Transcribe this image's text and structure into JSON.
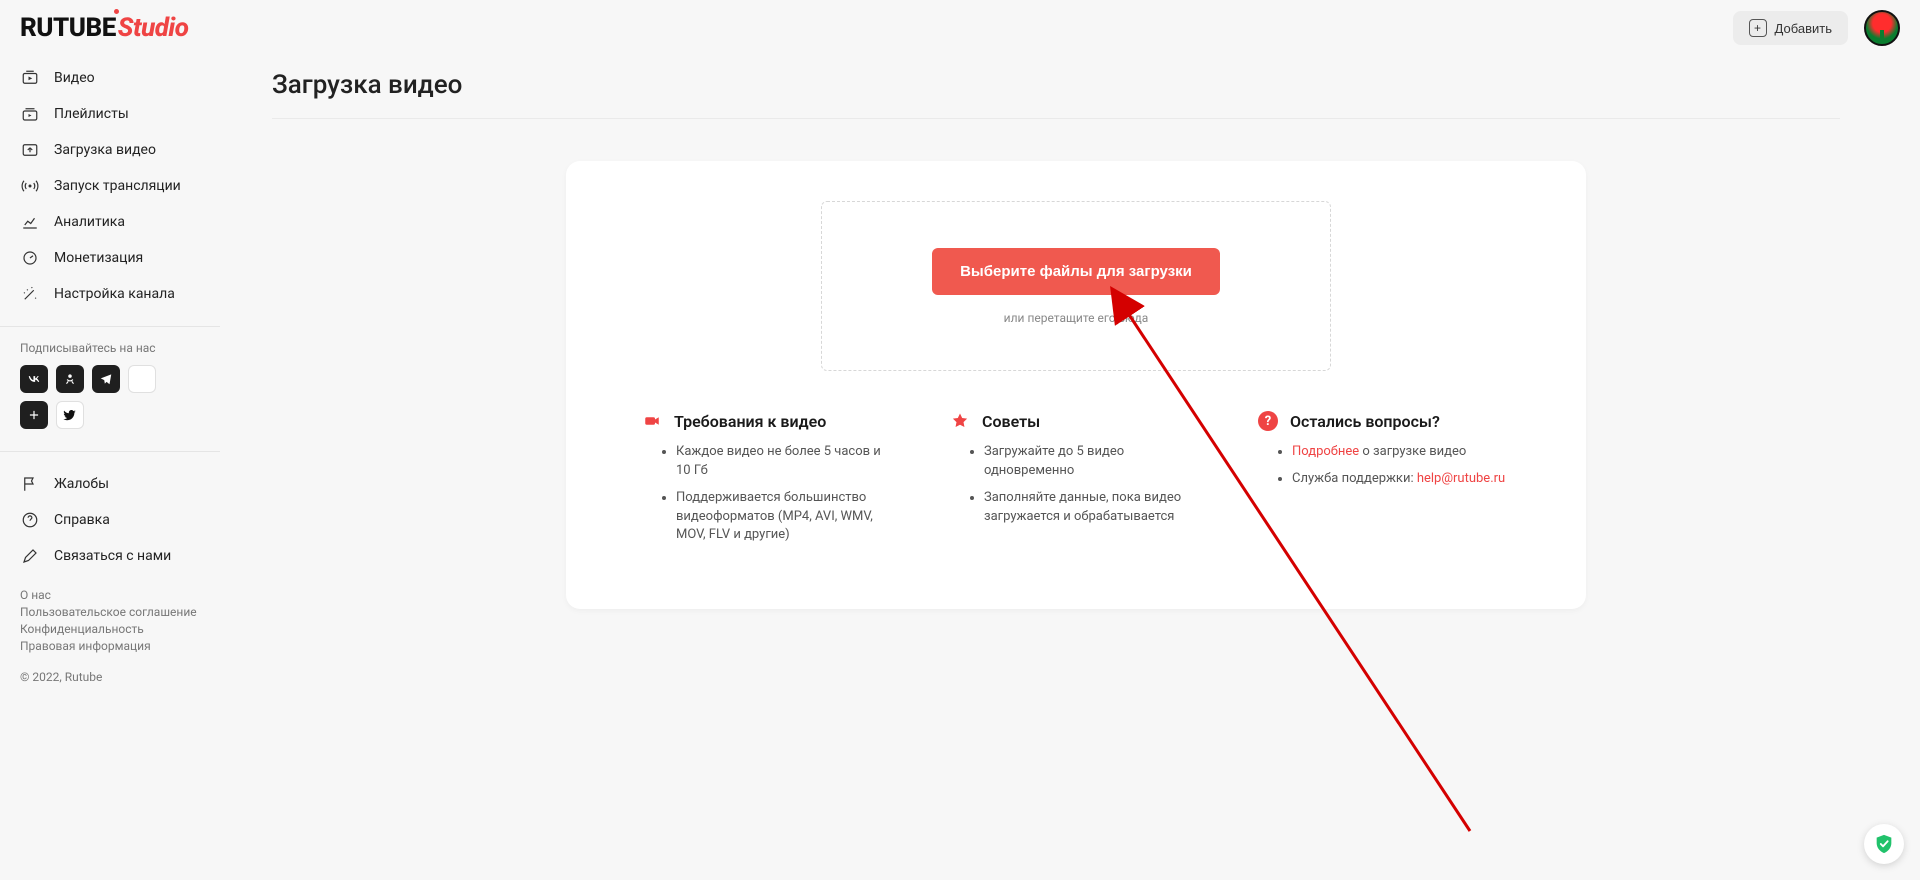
{
  "brand": {
    "part1": "RUTUBE",
    "part2": "Studio"
  },
  "header": {
    "add_label": "Добавить"
  },
  "sidebar": {
    "items": [
      {
        "label": "Видео"
      },
      {
        "label": "Плейлисты"
      },
      {
        "label": "Загрузка видео"
      },
      {
        "label": "Запуск трансляции"
      },
      {
        "label": "Аналитика"
      },
      {
        "label": "Монетизация"
      },
      {
        "label": "Настройка канала"
      }
    ],
    "subscribe_label": "Подписывайтесь на нас",
    "secondary": [
      {
        "label": "Жалобы"
      },
      {
        "label": "Справка"
      },
      {
        "label": "Связаться с нами"
      }
    ],
    "footer_links": [
      "О нас",
      "Пользовательское соглашение",
      "Конфиденциальность",
      "Правовая информация"
    ],
    "copyright": "© 2022, Rutube"
  },
  "page": {
    "title": "Загрузка видео"
  },
  "upload": {
    "button_label": "Выберите файлы для загрузки",
    "drag_hint": "или перетащите его сюда"
  },
  "info": {
    "requirements": {
      "title": "Требования к видео",
      "items": [
        "Каждое видео не более 5 часов и 10 Гб",
        "Поддерживается большинство видеоформатов (MP4, AVI, WMV, MOV, FLV и другие)"
      ]
    },
    "tips": {
      "title": "Советы",
      "items": [
        "Загружайте до 5 видео одновременно",
        "Заполняйте данные, пока видео загружается и обрабатывается"
      ]
    },
    "questions": {
      "title": "Остались вопросы?",
      "more_link_text": "Подробнее",
      "more_tail": " о загрузке видео",
      "support_prefix": "Служба поддержки: ",
      "support_email": "help@rutube.ru"
    }
  }
}
